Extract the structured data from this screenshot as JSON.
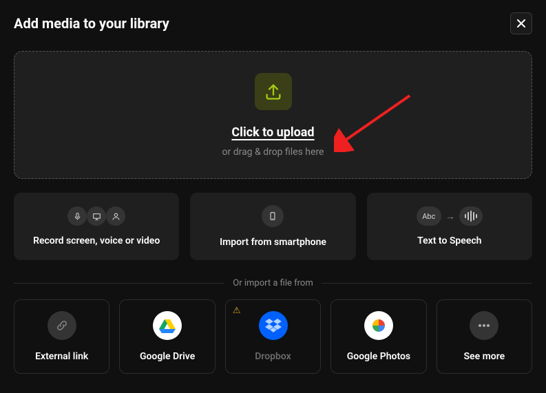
{
  "header": {
    "title": "Add media to your library"
  },
  "dropzone": {
    "title": "Click to upload",
    "subtitle": "or drag & drop files here"
  },
  "options": {
    "record_label": "Record screen, voice or video",
    "smartphone_label": "Import from smartphone",
    "tts_label": "Text to Speech",
    "abc_text": "Abc"
  },
  "divider": {
    "text": "Or import a file from"
  },
  "providers": {
    "external_link": "External link",
    "google_drive": "Google Drive",
    "dropbox": "Dropbox",
    "google_photos": "Google Photos",
    "see_more": "See more"
  }
}
